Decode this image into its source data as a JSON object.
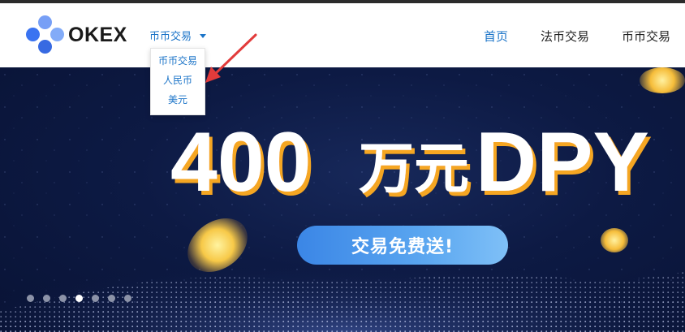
{
  "header": {
    "brand": "OKEX",
    "trade_select": {
      "label": "币币交易",
      "icon": "caret-down-icon"
    },
    "nav": [
      {
        "label": "首页",
        "active": true
      },
      {
        "label": "法币交易",
        "active": false
      },
      {
        "label": "币币交易",
        "active": false
      }
    ]
  },
  "dropdown": {
    "items": [
      "币币交易",
      "人民币",
      "美元"
    ]
  },
  "annotation": {
    "icon": "red-arrow-icon",
    "color": "#e23b3b"
  },
  "banner": {
    "headline_number": "400",
    "headline_unit": "万元",
    "headline_suffix": "DPY",
    "cta_label": "交易免费送!",
    "slides_total": 7,
    "active_slide": 4
  },
  "colors": {
    "accent": "#1b74c8",
    "banner_bg": "#0d1a44",
    "headline_shadow": "#f5a623",
    "cta": "#4a97ec"
  }
}
